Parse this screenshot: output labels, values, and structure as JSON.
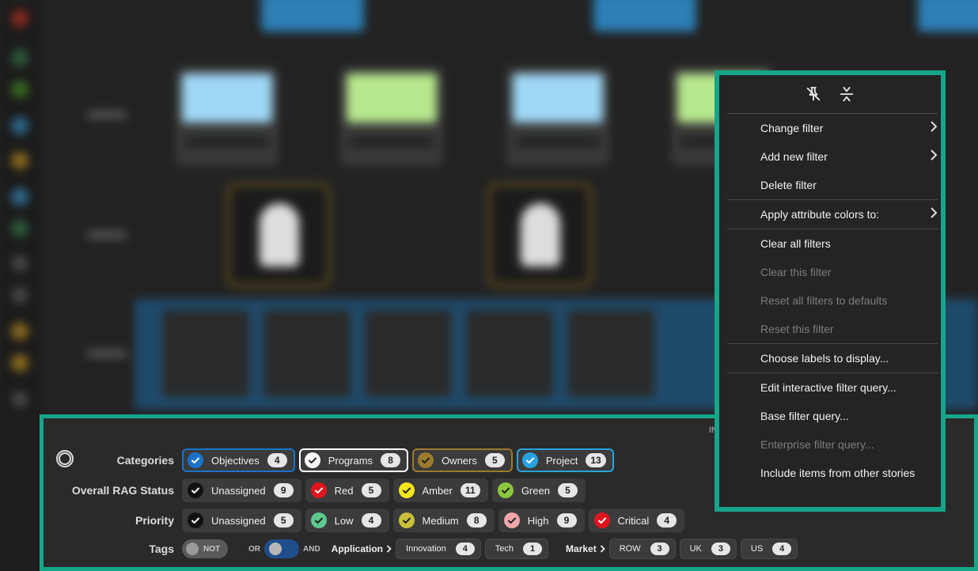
{
  "context_menu": {
    "toolbar": [
      {
        "icon": "unpin-icon"
      },
      {
        "icon": "collapse-vertical-icon"
      }
    ],
    "groups": [
      [
        {
          "label": "Change filter",
          "submenu": true,
          "enabled": true
        },
        {
          "label": "Add new filter",
          "submenu": true,
          "enabled": true
        },
        {
          "label": "Delete filter",
          "submenu": false,
          "enabled": true
        }
      ],
      [
        {
          "label": "Apply attribute colors to:",
          "submenu": true,
          "enabled": true
        }
      ],
      [
        {
          "label": "Clear all filters",
          "submenu": false,
          "enabled": true
        },
        {
          "label": "Clear this filter",
          "submenu": false,
          "enabled": false
        },
        {
          "label": "Reset all filters to defaults",
          "submenu": false,
          "enabled": false
        },
        {
          "label": "Reset this filter",
          "submenu": false,
          "enabled": false
        }
      ],
      [
        {
          "label": "Choose labels to display...",
          "submenu": false,
          "enabled": true
        }
      ],
      [
        {
          "label": "Edit interactive filter query...",
          "submenu": false,
          "enabled": true
        },
        {
          "label": "Base filter query...",
          "submenu": false,
          "enabled": true
        },
        {
          "label": "Enterprise filter query...",
          "submenu": false,
          "enabled": false
        },
        {
          "label": "Include items from other stories",
          "submenu": false,
          "enabled": true
        }
      ]
    ]
  },
  "filter_panel": {
    "header_fragment": "IN",
    "rows": [
      {
        "label": "Categories",
        "chips": [
          {
            "label": "Objectives",
            "count": "4",
            "check_color": "#1a73c9",
            "border_color": "#1a73c9",
            "check_mark_color": "#ffffff"
          },
          {
            "label": "Programs",
            "count": "8",
            "check_color": "#ffffff",
            "border_color": "#ffffff",
            "check_mark_color": "#222222"
          },
          {
            "label": "Owners",
            "count": "5",
            "check_color": "#9a7b2e",
            "border_color": "#9a7b2e",
            "check_mark_color": "#222222"
          },
          {
            "label": "Project",
            "count": "13",
            "check_color": "#29a3e0",
            "border_color": "#29a3e0",
            "check_mark_color": "#ffffff"
          }
        ]
      },
      {
        "label": "Overall RAG Status",
        "chips": [
          {
            "label": "Unassigned",
            "count": "9",
            "check_color": "#111111",
            "border_color": "",
            "check_mark_color": "#ffffff"
          },
          {
            "label": "Red",
            "count": "5",
            "check_color": "#e0141e",
            "border_color": "",
            "check_mark_color": "#ffffff"
          },
          {
            "label": "Amber",
            "count": "11",
            "check_color": "#f5e61c",
            "border_color": "",
            "check_mark_color": "#222222"
          },
          {
            "label": "Green",
            "count": "5",
            "check_color": "#8cc63f",
            "border_color": "",
            "check_mark_color": "#222222"
          }
        ]
      },
      {
        "label": "Priority",
        "chips": [
          {
            "label": "Unassigned",
            "count": "5",
            "check_color": "#111111",
            "border_color": "",
            "check_mark_color": "#ffffff"
          },
          {
            "label": "Low",
            "count": "4",
            "check_color": "#5cc98f",
            "border_color": "",
            "check_mark_color": "#222222"
          },
          {
            "label": "Medium",
            "count": "8",
            "check_color": "#c9c03a",
            "border_color": "",
            "check_mark_color": "#222222"
          },
          {
            "label": "High",
            "count": "9",
            "check_color": "#f2a7aa",
            "border_color": "",
            "check_mark_color": "#222222"
          },
          {
            "label": "Critical",
            "count": "4",
            "check_color": "#e0141e",
            "border_color": "",
            "check_mark_color": "#ffffff"
          }
        ]
      }
    ],
    "tags": {
      "label": "Tags",
      "not_toggle": {
        "text": "NOT",
        "on": false
      },
      "or_label": "OR",
      "and_label": "AND",
      "and_toggle_on": true,
      "groups": [
        {
          "label": "Application",
          "chips": [
            {
              "label": "Innovation",
              "count": "4"
            },
            {
              "label": "Tech",
              "count": "1"
            }
          ]
        },
        {
          "label": "Market",
          "chips": [
            {
              "label": "ROW",
              "count": "3"
            },
            {
              "label": "UK",
              "count": "3"
            },
            {
              "label": "US",
              "count": "4"
            }
          ]
        }
      ]
    }
  }
}
